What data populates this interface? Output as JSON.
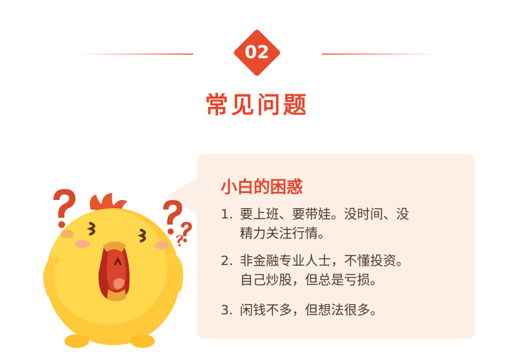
{
  "section": {
    "number": "02",
    "title": "常见问题"
  },
  "card": {
    "title": "小白的困惑",
    "items": [
      {
        "num": "1.",
        "line1": "要上班、要带娃。没时间、没",
        "line2": "精力关注行情。"
      },
      {
        "num": "2.",
        "line1": "非金融专业人士，不懂投资。",
        "line2": "自己炒股，但总是亏损。"
      },
      {
        "num": "3.",
        "line1": "闲钱不多，但想法很多。",
        "line2": ""
      }
    ]
  },
  "colors": {
    "accent": "#e8442a",
    "card_bg": "#fcefe6",
    "text": "#4a3a33",
    "mascot_body": "#ffcf3a"
  },
  "icons": {
    "mascot": "confused-chick-mascot"
  }
}
